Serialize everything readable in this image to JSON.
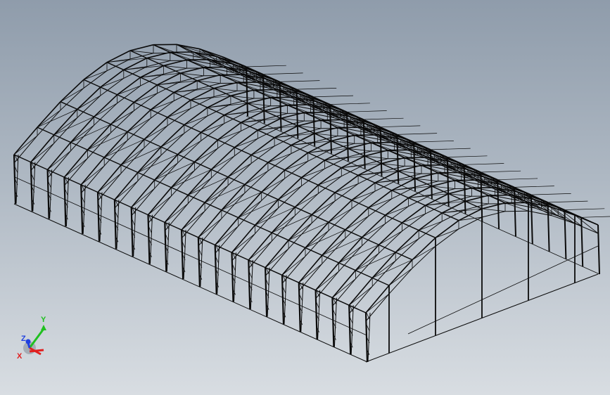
{
  "viewport": {
    "background_top": "#8f9cab",
    "background_bottom": "#d8dde2"
  },
  "model": {
    "description_icon": "steel-shed-frame-icon",
    "line_color": "#0a0a0a"
  },
  "triad": {
    "x_label": "X",
    "y_label": "Y",
    "z_label": "Z",
    "x_color": "#e02020",
    "y_color": "#20c020",
    "z_color": "#2040e0"
  }
}
